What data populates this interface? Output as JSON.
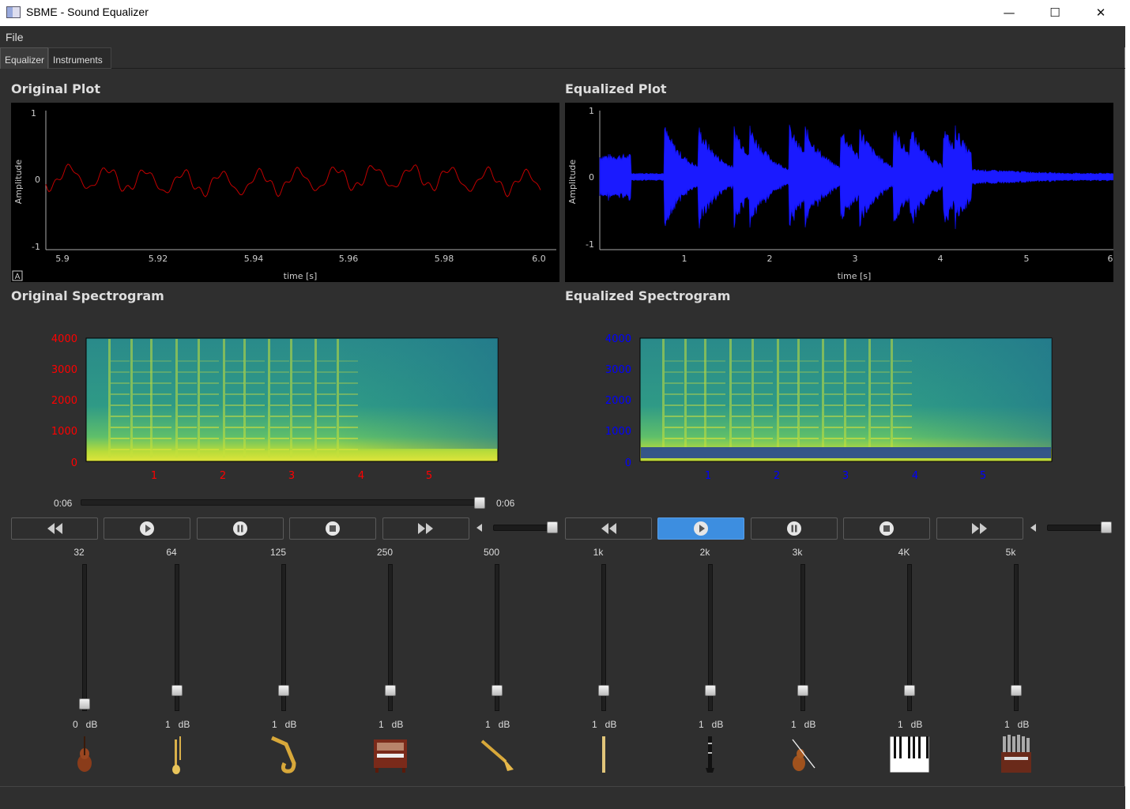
{
  "window": {
    "title": "SBME - Sound Equalizer",
    "minimize": "—",
    "maximize": "☐",
    "close": "✕"
  },
  "menu": {
    "file": "File"
  },
  "tabs": [
    {
      "label": "Equalizer"
    },
    {
      "label": "Instruments"
    }
  ],
  "plots": {
    "original": {
      "title": "Original Plot",
      "ylabel": "Amplitude",
      "xlabel": "time [s]",
      "yticks": [
        "1",
        "0",
        "-1"
      ],
      "xticks": [
        "5.9",
        "5.92",
        "5.94",
        "5.96",
        "5.98",
        "6.0"
      ],
      "corner_label": "A",
      "line_color": "#c00000"
    },
    "equalized": {
      "title": "Equalized Plot",
      "ylabel": "Amplitude",
      "xlabel": "time [s]",
      "yticks": [
        "1",
        "0",
        "-1"
      ],
      "xticks": [
        "1",
        "2",
        "3",
        "4",
        "5",
        "6"
      ],
      "line_color": "#1010ff"
    }
  },
  "spectrograms": {
    "original": {
      "title": "Original Spectrogram",
      "yticks": [
        "4000",
        "3000",
        "2000",
        "1000",
        "0"
      ],
      "xticks": [
        "1",
        "2",
        "3",
        "4",
        "5"
      ],
      "axis_color": "#ff0000"
    },
    "equalized": {
      "title": "Equalized Spectrogram",
      "yticks": [
        "4000",
        "3000",
        "2000",
        "1000",
        "0"
      ],
      "xticks": [
        "1",
        "2",
        "3",
        "4",
        "5"
      ],
      "axis_color": "#0000ff"
    }
  },
  "playback": {
    "elapsed": "0:06",
    "total": "0:06",
    "progress": 1.0,
    "original_volume": 1.0,
    "equalized_volume": 1.0
  },
  "controls": {
    "original": [
      "rewind-icon",
      "play-icon",
      "pause-icon",
      "stop-icon",
      "fast-forward-icon"
    ],
    "equalized": [
      "rewind-icon",
      "play-icon",
      "pause-icon",
      "stop-icon",
      "fast-forward-icon"
    ],
    "active": "equalized-play"
  },
  "bands": [
    {
      "label": "32",
      "gain": "0",
      "unit": "dB",
      "instrument": "cello-icon"
    },
    {
      "label": "64",
      "gain": "1",
      "unit": "dB",
      "instrument": "trombone-icon"
    },
    {
      "label": "125",
      "gain": "1",
      "unit": "dB",
      "instrument": "saxophone-icon"
    },
    {
      "label": "250",
      "gain": "1",
      "unit": "dB",
      "instrument": "organ-icon"
    },
    {
      "label": "500",
      "gain": "1",
      "unit": "dB",
      "instrument": "trumpet-icon"
    },
    {
      "label": "1k",
      "gain": "1",
      "unit": "dB",
      "instrument": "flute-icon"
    },
    {
      "label": "2k",
      "gain": "1",
      "unit": "dB",
      "instrument": "clarinet-icon"
    },
    {
      "label": "3k",
      "gain": "1",
      "unit": "dB",
      "instrument": "violin-icon"
    },
    {
      "label": "4K",
      "gain": "1",
      "unit": "dB",
      "instrument": "piano-keys-icon"
    },
    {
      "label": "5k",
      "gain": "1",
      "unit": "dB",
      "instrument": "pipe-organ-icon"
    }
  ]
}
